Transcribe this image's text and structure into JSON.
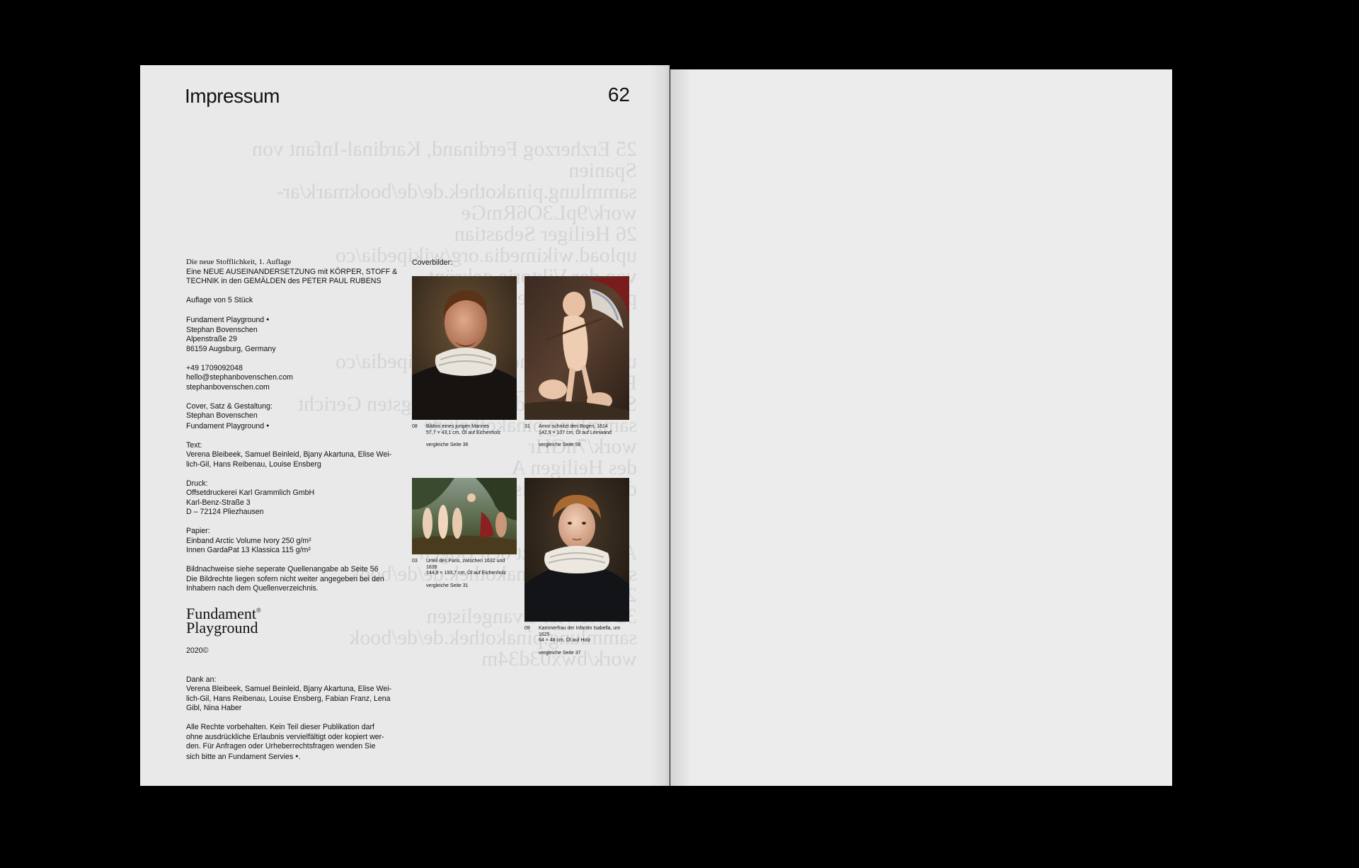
{
  "page": {
    "title": "Impressum",
    "number": "62"
  },
  "ghost_lines": [
    "25 Erzherzog Ferdinand, Kardinal-Infant von",
    "Spanien",
    "sammlung.pinakothek.de/de/bookmark/ar-",
    "work/9pL3O6RmGe",
    "26 Heiliger Sebastian",
    "upload.wikimedia.org/wikipedia/co",
    "von der Viktorie gekrönt",
    "pinakothek.de/de/bookm",
    "",
    "",
    "upload.wikimedia.org/wikipedia/co",
    "Paul_Rubens_10",
    "Sturz der Verdammten Jüngsten Gericht",
    "sammlung.pinakothek.de",
    "work/7nGHr",
    "des Heiligen A",
    "des hl. Franziskus Wi",
    "",
    "",
    "Amor schnitzt den Bogen",
    "sammlung.pinakothek.de/de/book",
    "2xnOg94Pd",
    "32 Die vier Evangelisten",
    "sammlung.pinakothek.de/de/book",
    "work/bwx03d34m"
  ],
  "colophon": {
    "edition_title": "Die neue Stofflichkeit, 1. Auflage",
    "subtitle_lines": [
      "Eine NEUE AUSEINANDERSETZUNG mit KÖRPER, STOFF &",
      "TECHNIK in den GEMÄLDEN des PETER PAUL RUBENS"
    ],
    "print_run": "Auflage von 5 Stück",
    "publisher_lines": [
      "Fundament Playground",
      "Stephan Bovenschen",
      "Alpenstraße 29",
      "86159 Augsburg, Germany"
    ],
    "contact_lines": [
      "+49 1709092048",
      "hello@stephanbovenschen.com",
      "stephanbovenschen.com"
    ],
    "design_lines": [
      "Cover, Satz & Gestaltung:",
      "Stephan Bovenschen",
      "Fundament Playground"
    ],
    "text_lines": [
      "Text:",
      "Verena Bleibeek, Samuel Beinleid, Bjany Akartuna, Elise Wei-",
      "lich-Gil, Hans Reibenau, Louise Ensberg"
    ],
    "print_lines": [
      "Druck:",
      "Offsetdruckerei Karl Grammlich GmbH",
      "Karl-Benz-Straße 3",
      "D – 72124 Pliezhausen"
    ],
    "paper_lines": [
      "Papier:",
      "Einband Arctic Volume Ivory 250 g/m²",
      "Innen GardaPat 13 Klassica 115 g/m²"
    ],
    "credits_lines": [
      "Bildnachweise siehe seperate Quellenangabe ab Seite 56",
      "Die Bildrechte liegen sofern nicht weiter angegeben bei den",
      "Inhabern nach dem Quellenverzeichnis."
    ],
    "logo_line1": "Fundament",
    "logo_line2": "Playground",
    "logo_mark": "®",
    "year": "2020©",
    "thanks_lines": [
      "Dank an:",
      "Verena Bleibeek, Samuel Beinleid, Bjany Akartuna, Elise Wei-",
      "lich-Gil, Hans Reibenau, Louise Ensberg, Fabian Franz, Lena",
      "Gibl, Nina Haber"
    ],
    "rights_lines": [
      "Alle Rechte vorbehalten. Kein Teil dieser Publikation darf",
      "ohne ausdrückliche Erlaubnis vervielfältigt oder kopiert wer-",
      "den. Für Anfragen oder Urheberrechtsfragen wenden Sie",
      "sich bitte an Fundament Servies"
    ],
    "circle_mark": "●"
  },
  "covers": {
    "label": "Coverbilder:",
    "items": [
      {
        "num": "08",
        "title": "Bildnis eines jungen Mannes",
        "details": "57,7 × 43,1 cm, Öl auf Eichenholz",
        "ref": "vergleiche Seite 36"
      },
      {
        "num": "31",
        "title": "Amor schnitzt den Bogen, 1614",
        "details": "142,5 × 107 cm, Öl auf Leinwand",
        "ref": "vergleiche Seite 56"
      },
      {
        "num": "03",
        "title": "Urteil des Paris, zwischen 1632 und 1635",
        "details": "144,8 × 193,7 cm, Öl auf Eichenholz",
        "ref": "vergleiche Seite 31"
      },
      {
        "num": "09",
        "title": "Kammerfrau der Infantin Isabella, um 1625",
        "details": "64 × 48 cm, Öl auf Holz",
        "ref": "vergleiche Seite 37"
      }
    ]
  }
}
